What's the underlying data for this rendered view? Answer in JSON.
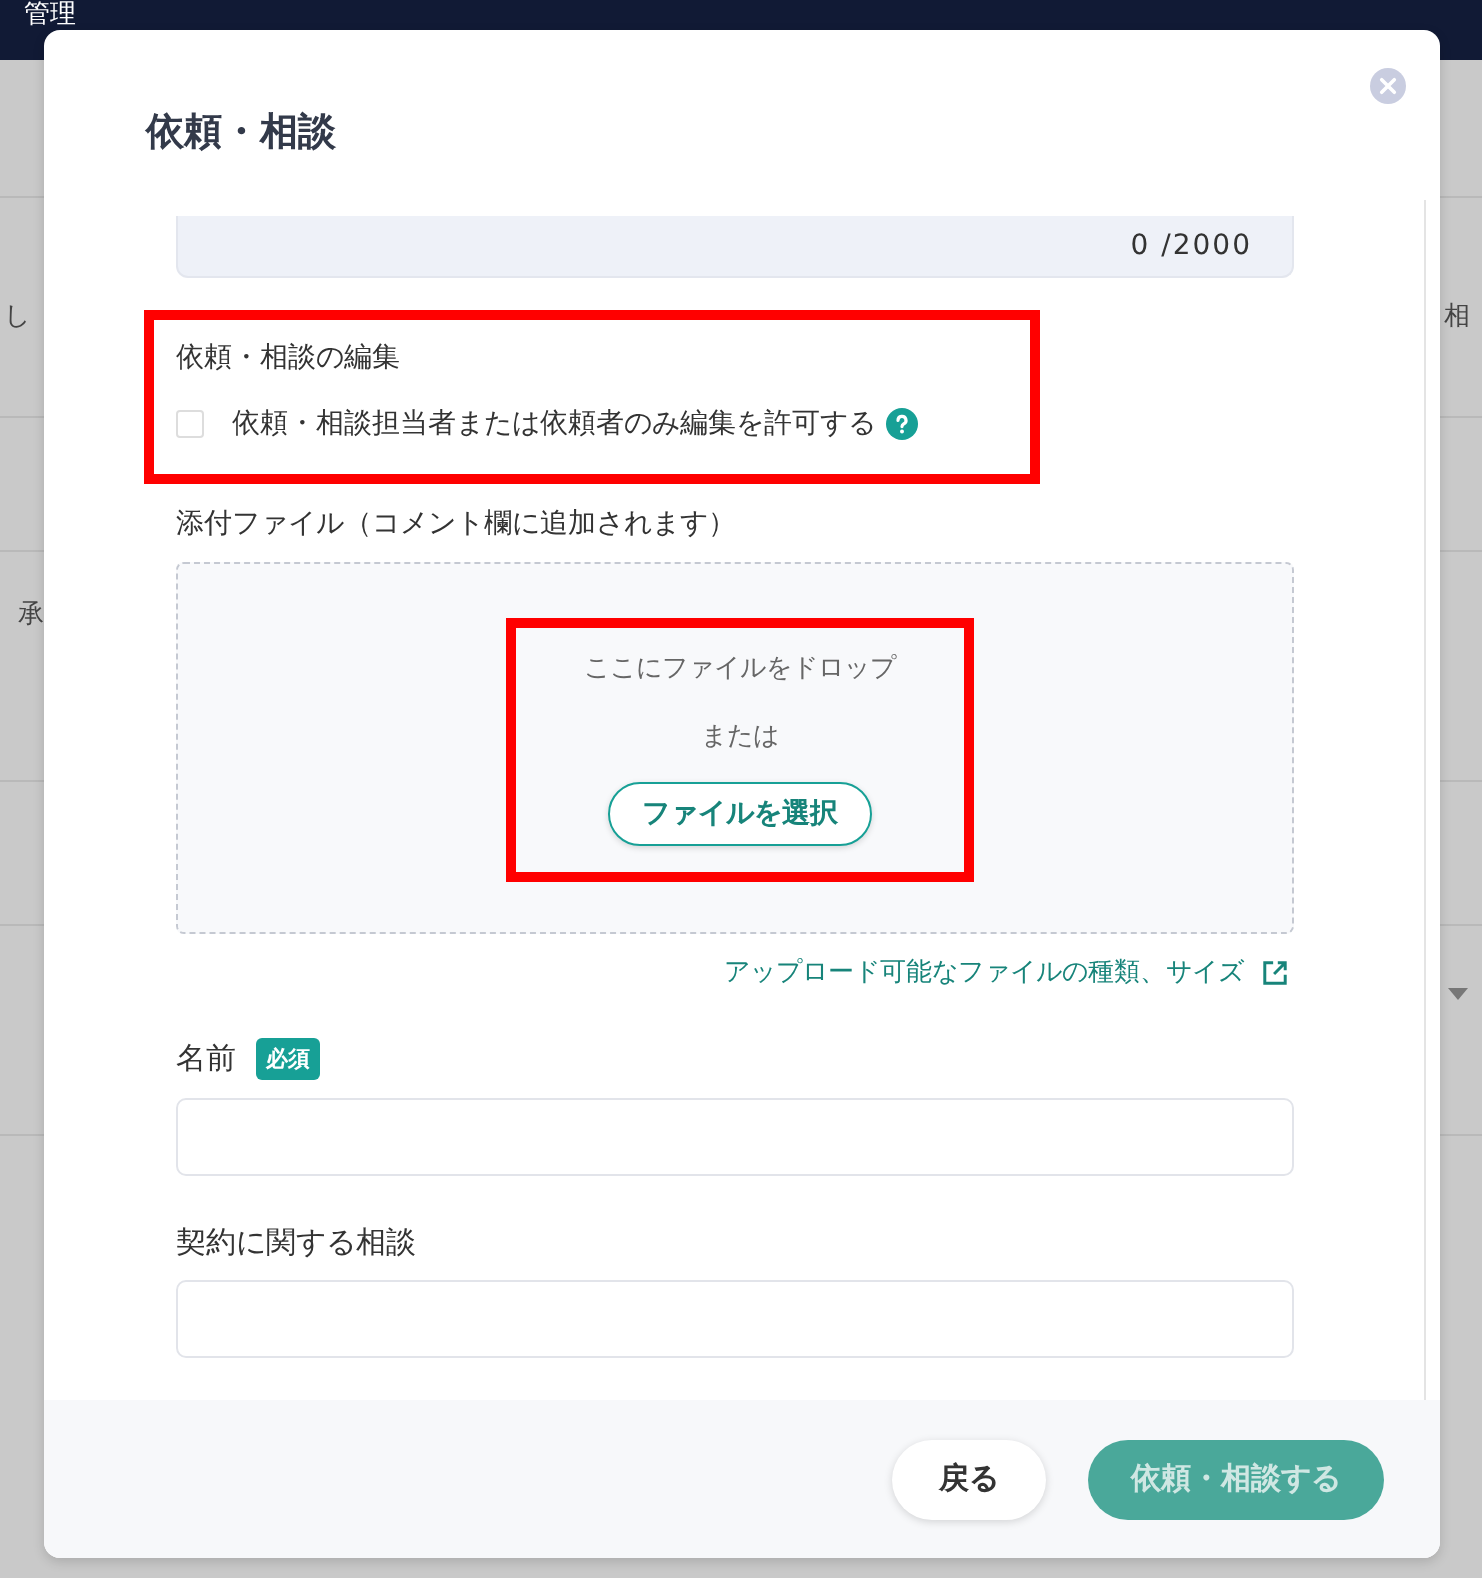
{
  "background": {
    "header_title": "管理",
    "fragments": [
      {
        "text": "し"
      },
      {
        "text": "相"
      },
      {
        "text": "承"
      }
    ]
  },
  "dialog": {
    "title": "依頼・相談",
    "textarea": {
      "counter": "0 /2000"
    },
    "edit_section": {
      "label": "依頼・相談の編集",
      "highlighted": true,
      "checkbox": {
        "label": "依頼・相談担当者または依頼者のみ編集を許可する",
        "checked": false
      }
    },
    "attachments": {
      "label": "添付ファイル（コメント欄に追加されます）",
      "dropzone": {
        "drop_text": "ここにファイルをドロップ",
        "or_text": "または",
        "button": "ファイルを選択",
        "highlighted": true
      },
      "link": "アップロード可能なファイルの種類、サイズ"
    },
    "fields": [
      {
        "label": "名前",
        "badge": "必須"
      },
      {
        "label": "契約に関する相談"
      }
    ],
    "buttons": [
      {
        "label": "戻る",
        "kind": "secondary"
      },
      {
        "label": "依頼・相談する",
        "kind": "primary",
        "disabled": true
      }
    ]
  }
}
